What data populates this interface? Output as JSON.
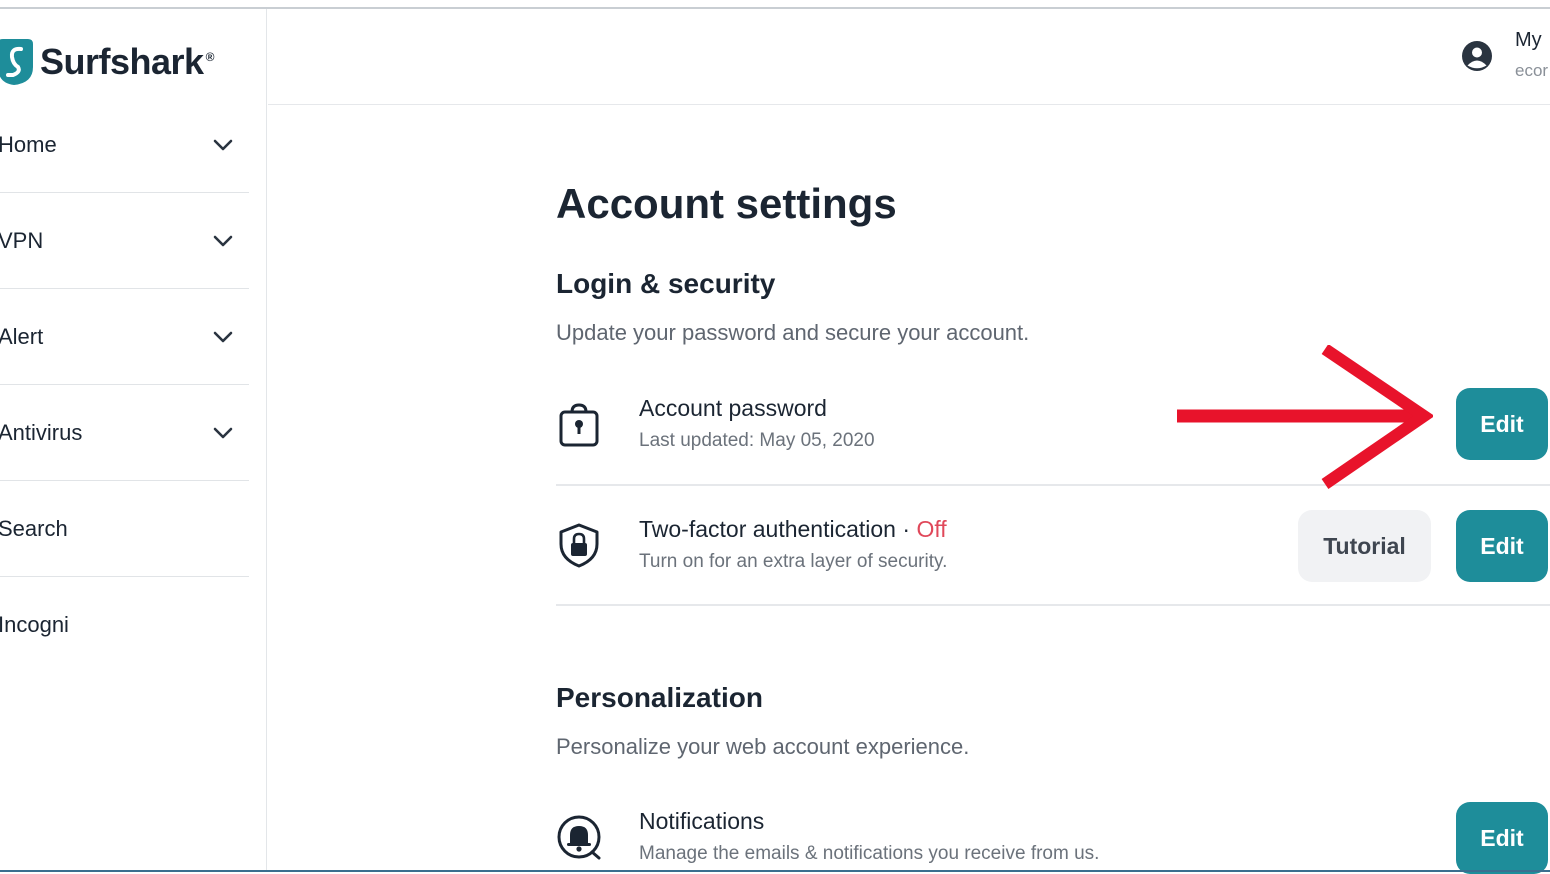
{
  "brand": {
    "name": "Surfshark",
    "reg": "®",
    "color": "#1e8d9a"
  },
  "sidebar": {
    "items": [
      {
        "label": "Home",
        "icon": "chevron-down-icon"
      },
      {
        "label": "VPN",
        "icon": "chevron-down-icon"
      },
      {
        "label": "Alert",
        "icon": "chevron-down-icon"
      },
      {
        "label": "Antivirus",
        "icon": "chevron-down-icon"
      },
      {
        "label": "Search"
      },
      {
        "label": "Incogni"
      }
    ]
  },
  "header": {
    "user_label": "My",
    "user_email_fragment": "ecor",
    "user_icon": "account-circle-icon"
  },
  "main": {
    "title": "Account settings",
    "login_security": {
      "title": "Login & security",
      "description": "Update your password and secure your account.",
      "rows": [
        {
          "title": "Account password",
          "subtitle": "Last updated: May 05, 2020",
          "icon": "lock-bag-icon",
          "edit_label": "Edit"
        },
        {
          "title": "Two-factor authentication",
          "separator": "·",
          "status": "Off",
          "subtitle": "Turn on for an extra layer of security.",
          "icon": "shield-lock-icon",
          "tutorial_label": "Tutorial",
          "edit_label": "Edit"
        }
      ]
    },
    "personalization": {
      "title": "Personalization",
      "description": "Personalize your web account experience.",
      "rows": [
        {
          "title": "Notifications",
          "subtitle": "Manage the emails & notifications you receive from us.",
          "icon": "bell-icon",
          "edit_label": "Edit"
        }
      ]
    }
  },
  "annotation": {
    "arrow_color": "#e8132b",
    "points_to": "account-password-edit-button"
  },
  "colors": {
    "edit_button": "#1e8d9a",
    "status_off": "#e0485a",
    "tutorial_button": "#f1f2f4"
  }
}
